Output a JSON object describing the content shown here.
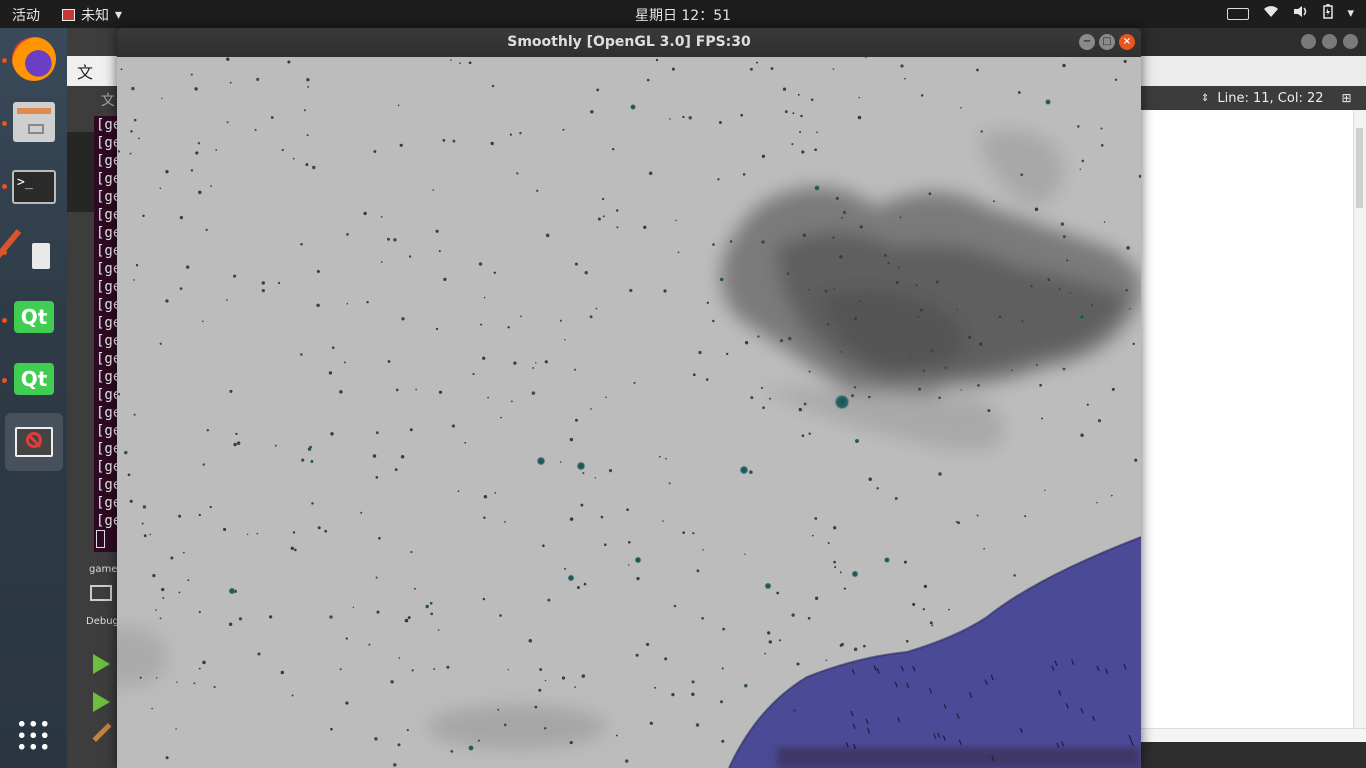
{
  "topbar": {
    "activities": "活动",
    "app_name": "未知",
    "clock": "星期日 12：51",
    "tray_menu_arrow": "▾"
  },
  "dock": {
    "items": [
      {
        "name": "firefox",
        "icon": "firefox-icon",
        "running": true
      },
      {
        "name": "files",
        "icon": "files-icon",
        "running": true
      },
      {
        "name": "terminal",
        "icon": "terminal-icon",
        "running": true
      },
      {
        "name": "paint",
        "icon": "paint-icon",
        "running": true
      },
      {
        "name": "qt-creator",
        "icon": "qt-icon",
        "running": true
      },
      {
        "name": "qt-designer",
        "icon": "qt-icon",
        "running": true
      },
      {
        "name": "unknown-app",
        "icon": "forbidden-icon",
        "running": false,
        "active": true
      }
    ],
    "terminal_prompt": ">_",
    "qt_label": "Qt"
  },
  "background": {
    "qt_creator": {
      "file_button": "文",
      "file_label": "文",
      "target_label": "game",
      "debug_label": "Debug",
      "terminal_line": "[ge"
    },
    "editor": {
      "status": "Line: 11, Col: 22"
    }
  },
  "game_window": {
    "title": "Smoothly [OpenGL 3.0] FPS:30",
    "minimize": "−",
    "maximize": "□",
    "close": "×",
    "colors": {
      "sky": "#bcbcbc",
      "cloud": "#5e5e5e",
      "ground": "#4b4a96",
      "star": "#1f5b5b"
    }
  }
}
